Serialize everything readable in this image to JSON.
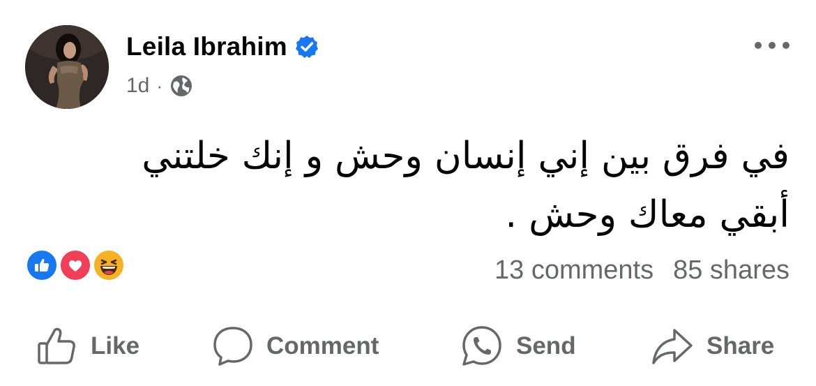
{
  "post": {
    "author": "Leila Ibrahim",
    "timestamp": "1d",
    "separator": "·",
    "audience_icon": "globe-icon",
    "verified_icon": "verified-badge-icon",
    "text_line1": "في فرق بين إني إنسان وحش و إنك خلتني",
    "text_line2": "أبقي معاك وحش ."
  },
  "reactions": [
    "like-reaction-icon",
    "love-reaction-icon",
    "haha-reaction-icon"
  ],
  "counts": {
    "comments": "13 comments",
    "shares": "85 shares"
  },
  "actions": {
    "like": "Like",
    "comment": "Comment",
    "send": "Send",
    "share": "Share"
  },
  "colors": {
    "text": "#050505",
    "secondary": "#65676b",
    "facebook_blue": "#1877f2",
    "love_red": "#f33e58",
    "haha_yellow": "#f7b125"
  }
}
